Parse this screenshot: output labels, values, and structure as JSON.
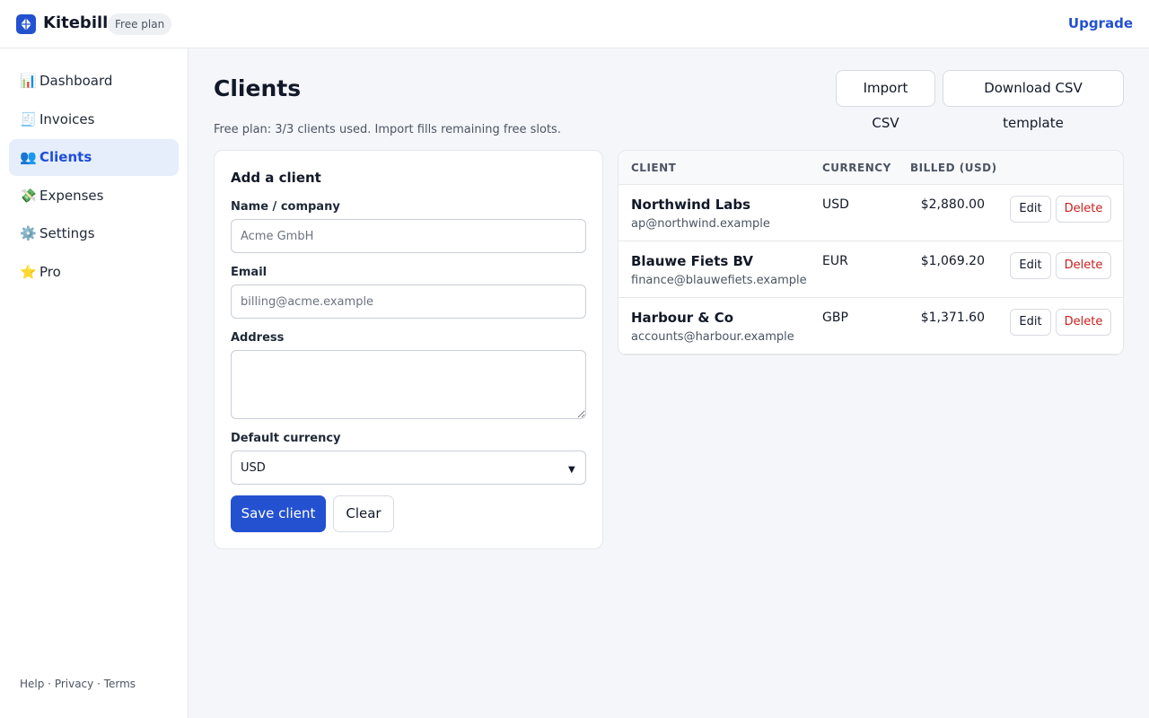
{
  "app": {
    "brand": "Kitebill",
    "plan_badge": "Free plan",
    "upgrade_label": "Upgrade",
    "accent_color": "#2351d0"
  },
  "sidebar": {
    "items": [
      {
        "icon": "📊",
        "icon_name": "bar-chart-icon",
        "label": "Dashboard",
        "active": false
      },
      {
        "icon": "🧾",
        "icon_name": "receipt-icon",
        "label": "Invoices",
        "active": false
      },
      {
        "icon": "👥",
        "icon_name": "people-icon",
        "label": "Clients",
        "active": true
      },
      {
        "icon": "💸",
        "icon_name": "money-icon",
        "label": "Expenses",
        "active": false
      },
      {
        "icon": "⚙️",
        "icon_name": "gear-icon",
        "label": "Settings",
        "active": false
      },
      {
        "icon": "⭐",
        "icon_name": "star-icon",
        "label": "Pro",
        "active": false
      }
    ],
    "footer": {
      "help": "Help",
      "sep": " · ",
      "privacy": "Privacy",
      "terms": "Terms"
    }
  },
  "page": {
    "title": "Clients",
    "import_label": "Import CSV",
    "template_label": "Download CSV template",
    "plan_note": "Free plan: 3/3 clients used. Import fills remaining free slots."
  },
  "form": {
    "title": "Add a client",
    "name_label": "Name / company",
    "name_placeholder": "Acme GmbH",
    "email_label": "Email",
    "email_placeholder": "billing@acme.example",
    "address_label": "Address",
    "currency_label": "Default currency",
    "currency_value": "USD",
    "save_label": "Save client",
    "clear_label": "Clear"
  },
  "table": {
    "headers": {
      "client": "CLIENT",
      "currency": "CURRENCY",
      "billed": "BILLED (USD)"
    },
    "edit_label": "Edit",
    "delete_label": "Delete",
    "rows": [
      {
        "name": "Northwind Labs",
        "email": "ap@northwind.example",
        "currency": "USD",
        "billed": "$2,880.00"
      },
      {
        "name": "Blauwe Fiets BV",
        "email": "finance@blauwefiets.example",
        "currency": "EUR",
        "billed": "$1,069.20"
      },
      {
        "name": "Harbour & Co",
        "email": "accounts@harbour.example",
        "currency": "GBP",
        "billed": "$1,371.60"
      }
    ]
  }
}
